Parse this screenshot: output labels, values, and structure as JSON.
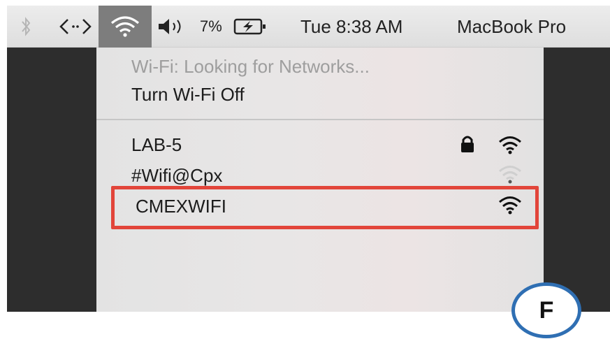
{
  "menubar": {
    "battery_percent": "7%",
    "clock": "Tue 8:38 AM",
    "host": "MacBook Pro",
    "icons": [
      "bluetooth-icon",
      "code-icon",
      "wifi-icon",
      "volume-icon",
      "battery-charging-icon"
    ]
  },
  "wifi_menu": {
    "status": "Wi-Fi: Looking for Networks...",
    "toggle_label": "Turn Wi-Fi Off",
    "networks": [
      {
        "name": "LAB-5",
        "locked": true,
        "signal": "strong"
      },
      {
        "name": "#Wifi@Cpx",
        "locked": false,
        "signal": "weak"
      },
      {
        "name": "CMEXWIFI",
        "locked": false,
        "signal": "strong",
        "highlighted": true
      }
    ]
  },
  "callout": {
    "label": "F"
  },
  "colors": {
    "highlight": "#e2453a",
    "badge_border": "#2f6fb3",
    "menubar_active": "#7d7d7d"
  }
}
